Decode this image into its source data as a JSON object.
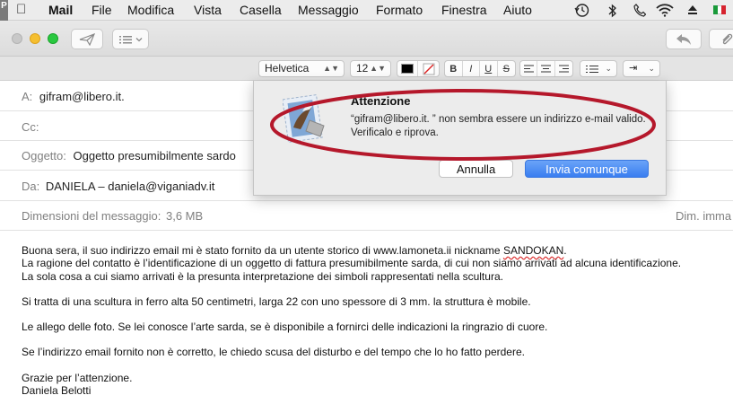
{
  "menubar": {
    "app_name": "Mail",
    "items": [
      "File",
      "Modifica",
      "Vista",
      "Casella",
      "Messaggio",
      "Formato",
      "Finestra",
      "Aiuto"
    ],
    "left_badge": "P",
    "icons": [
      "apple-icon",
      "time-machine-icon",
      "bluetooth-icon",
      "phone-icon",
      "wifi-icon",
      "eject-icon",
      "flag-italy-icon"
    ]
  },
  "formatbar": {
    "font": "Helvetica",
    "size": "12",
    "bold": "B",
    "italic": "I",
    "underline": "U",
    "strike": "S"
  },
  "header": {
    "to_label": "A:",
    "to_value": "gifram@libero.it.",
    "cc_label": "Cc:",
    "subject_label": "Oggetto:",
    "subject_value": "Oggetto presumibilmente sardo",
    "from_label": "Da:",
    "from_value": "DANIELA – daniela@viganiadv.it",
    "size_label": "Dimensioni del messaggio:",
    "size_value": "3,6 MB",
    "image_size_label": "Dim. imma"
  },
  "dialog": {
    "title": "Attenzione",
    "message": "“gifram@libero.it. ” non sembra essere un indirizzo e-mail valido. Verificalo e riprova.",
    "cancel_label": "Annulla",
    "confirm_label": "Invia comunque",
    "highlight_color": "#b5182b"
  },
  "body": {
    "line1a": "Buona sera, il suo indirizzo email mi è stato fornito da un utente storico di www.lamoneta.ii nickname ",
    "line1b": "SANDOKAN",
    "line1c": ".",
    "line2": "La ragione del contatto è l’identificazione di un oggetto di fattura presumibilmente sarda, di cui non siamo arrivati ad alcuna identificazione.",
    "line3": "La sola cosa a cui siamo arrivati è la presunta interpretazione dei simboli rappresentati nella scultura.",
    "line4": "Si tratta di una scultura in ferro alta 50 centimetri, larga 22 con uno spessore di 3 mm. la struttura è mobile.",
    "line5": "Le allego delle foto. Se lei conosce l’arte sarda, se è disponibile a fornirci delle indicazioni la ringrazio di cuore.",
    "line6": "Se l’indirizzo email fornito non è corretto, le chiedo scusa del disturbo e del tempo che lo ho fatto perdere.",
    "line7": "Grazie per l’attenzione.",
    "line8": "Daniela Belotti"
  }
}
